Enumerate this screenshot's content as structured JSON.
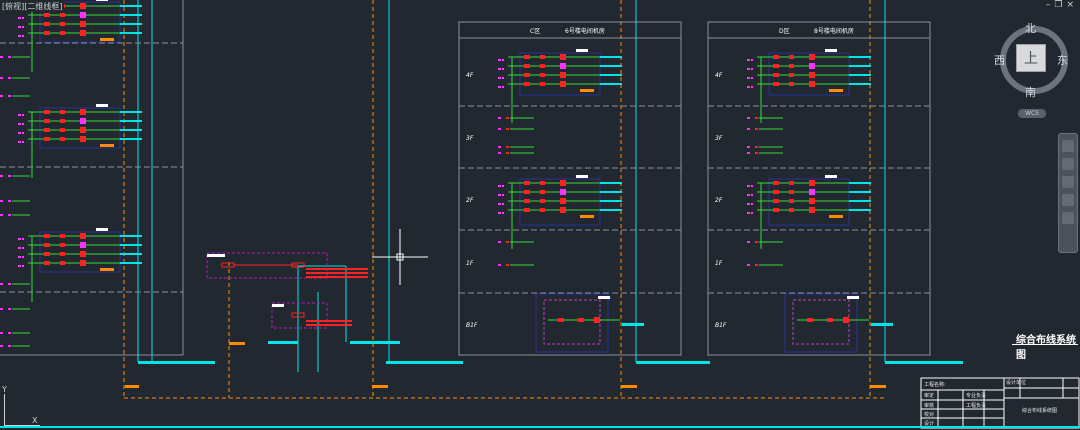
{
  "viewport": {
    "label": "[俯视][二维线框]"
  },
  "window_controls": {
    "minimize": "–",
    "restore": "❐",
    "close": "×"
  },
  "viewcube": {
    "north": "北",
    "south": "南",
    "east": "东",
    "west": "西",
    "face": "上",
    "wcs": "WCS"
  },
  "sections": [
    {
      "zone": "C区",
      "name": "6号楼电间机房"
    },
    {
      "zone": "D区",
      "name": "8号楼电间机房"
    }
  ],
  "floors": [
    "4F",
    "3F",
    "2F",
    "1F",
    "B1F"
  ],
  "drawing_title": "综合布线系统图",
  "title_block": {
    "project_label": "工程名称:",
    "design_unit": "设计单位",
    "cells": [
      "审定",
      "审核",
      "校对",
      "设计",
      "专业负责",
      "工程负责"
    ],
    "drawing_name": "综合布线系统图"
  },
  "ucs": {
    "x": "X",
    "y": "Y"
  },
  "colors": {
    "background": "#212830",
    "cyan": "#00e5e5",
    "green": "#33dd33",
    "red": "#ff2222",
    "magenta": "#ff33ff",
    "orange": "#ff8c00",
    "navy": "#2a2f9a",
    "grey": "#8a9098"
  }
}
